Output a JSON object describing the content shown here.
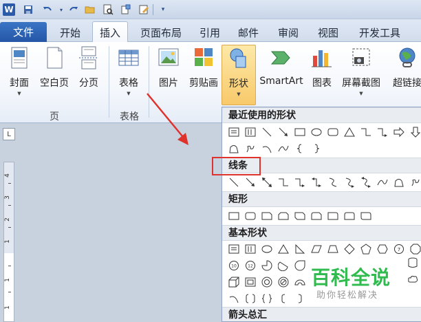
{
  "titlebar": {
    "icons": [
      "word-logo-icon",
      "save-icon",
      "undo-icon",
      "redo-icon",
      "open-folder-icon",
      "print-preview-icon",
      "insert-icon",
      "edit-icon",
      "customize-quick-access-icon"
    ]
  },
  "tabs": [
    {
      "label": "文件",
      "kind": "file"
    },
    {
      "label": "开始"
    },
    {
      "label": "插入",
      "active": true
    },
    {
      "label": "页面布局"
    },
    {
      "label": "引用"
    },
    {
      "label": "邮件"
    },
    {
      "label": "审阅"
    },
    {
      "label": "视图"
    },
    {
      "label": "开发工具"
    }
  ],
  "ribbon": {
    "buttons": {
      "cover": "封面",
      "blank_page": "空白页",
      "page_break": "分页",
      "table": "表格",
      "picture": "图片",
      "clipart": "剪贴画",
      "shapes": "形状",
      "smartart": "SmartArt",
      "chart": "图表",
      "screenshot": "屏幕截图",
      "hyperlink": "超链接"
    },
    "groups": {
      "pages": "页",
      "tables": "表格"
    }
  },
  "ruler": {
    "numbers": [
      "4",
      "3",
      "2",
      "1",
      "1",
      "1"
    ]
  },
  "dropdown": {
    "sections": {
      "recent": "最近使用的形状",
      "lines": "线条",
      "rectangles": "矩形",
      "basic": "基本形状",
      "arrows": "箭头总汇"
    }
  },
  "watermark": {
    "title": "百科全说",
    "subtitle": "助你轻松解决"
  },
  "colors": {
    "accent_blue": "#2556a8",
    "pressed_gold": "#f8c96a",
    "annotation_red": "#e0322d",
    "watermark_green": "#2fbb4d"
  }
}
